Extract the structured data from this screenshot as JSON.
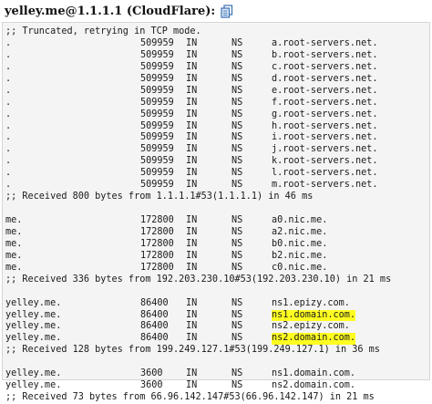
{
  "header": {
    "title": "yelley.me@1.1.1.1 (CloudFlare):",
    "copy_icon": "copy-icon"
  },
  "colors": {
    "highlight": "#ffff22",
    "panel_bg": "#f4f4f4"
  },
  "output": {
    "note": ";; Truncated, retrying in TCP mode.",
    "root": [
      {
        "name": ".",
        "ttl": "509959",
        "class": "IN",
        "type": "NS",
        "value": "a.root-servers.net."
      },
      {
        "name": ".",
        "ttl": "509959",
        "class": "IN",
        "type": "NS",
        "value": "b.root-servers.net."
      },
      {
        "name": ".",
        "ttl": "509959",
        "class": "IN",
        "type": "NS",
        "value": "c.root-servers.net."
      },
      {
        "name": ".",
        "ttl": "509959",
        "class": "IN",
        "type": "NS",
        "value": "d.root-servers.net."
      },
      {
        "name": ".",
        "ttl": "509959",
        "class": "IN",
        "type": "NS",
        "value": "e.root-servers.net."
      },
      {
        "name": ".",
        "ttl": "509959",
        "class": "IN",
        "type": "NS",
        "value": "f.root-servers.net."
      },
      {
        "name": ".",
        "ttl": "509959",
        "class": "IN",
        "type": "NS",
        "value": "g.root-servers.net."
      },
      {
        "name": ".",
        "ttl": "509959",
        "class": "IN",
        "type": "NS",
        "value": "h.root-servers.net."
      },
      {
        "name": ".",
        "ttl": "509959",
        "class": "IN",
        "type": "NS",
        "value": "i.root-servers.net."
      },
      {
        "name": ".",
        "ttl": "509959",
        "class": "IN",
        "type": "NS",
        "value": "j.root-servers.net."
      },
      {
        "name": ".",
        "ttl": "509959",
        "class": "IN",
        "type": "NS",
        "value": "k.root-servers.net."
      },
      {
        "name": ".",
        "ttl": "509959",
        "class": "IN",
        "type": "NS",
        "value": "l.root-servers.net."
      },
      {
        "name": ".",
        "ttl": "509959",
        "class": "IN",
        "type": "NS",
        "value": "m.root-servers.net."
      }
    ],
    "root_received": ";; Received 800 bytes from 1.1.1.1#53(1.1.1.1) in 46 ms",
    "me": [
      {
        "name": "me.",
        "ttl": "172800",
        "class": "IN",
        "type": "NS",
        "value": "a0.nic.me."
      },
      {
        "name": "me.",
        "ttl": "172800",
        "class": "IN",
        "type": "NS",
        "value": "a2.nic.me."
      },
      {
        "name": "me.",
        "ttl": "172800",
        "class": "IN",
        "type": "NS",
        "value": "b0.nic.me."
      },
      {
        "name": "me.",
        "ttl": "172800",
        "class": "IN",
        "type": "NS",
        "value": "b2.nic.me."
      },
      {
        "name": "me.",
        "ttl": "172800",
        "class": "IN",
        "type": "NS",
        "value": "c0.nic.me."
      }
    ],
    "me_received": ";; Received 336 bytes from 192.203.230.10#53(192.203.230.10) in 21 ms",
    "yelley": [
      {
        "name": "yelley.me.",
        "ttl": "86400",
        "class": "IN",
        "type": "NS",
        "value": "ns1.epizy.com."
      },
      {
        "name": "yelley.me.",
        "ttl": "86400",
        "class": "IN",
        "type": "NS",
        "value": "ns1.domain.com.",
        "highlight": true
      },
      {
        "name": "yelley.me.",
        "ttl": "86400",
        "class": "IN",
        "type": "NS",
        "value": "ns2.epizy.com."
      },
      {
        "name": "yelley.me.",
        "ttl": "86400",
        "class": "IN",
        "type": "NS",
        "value": "ns2.domain.com.",
        "highlight": true
      }
    ],
    "yelley_received": ";; Received 128 bytes from 199.249.127.1#53(199.249.127.1) in 36 ms",
    "final": [
      {
        "name": "yelley.me.",
        "ttl": "3600",
        "class": "IN",
        "type": "NS",
        "value": "ns1.domain.com."
      },
      {
        "name": "yelley.me.",
        "ttl": "3600",
        "class": "IN",
        "type": "NS",
        "value": "ns2.domain.com."
      }
    ],
    "final_received": ";; Received 73 bytes from 66.96.142.147#53(66.96.142.147) in 21 ms"
  }
}
